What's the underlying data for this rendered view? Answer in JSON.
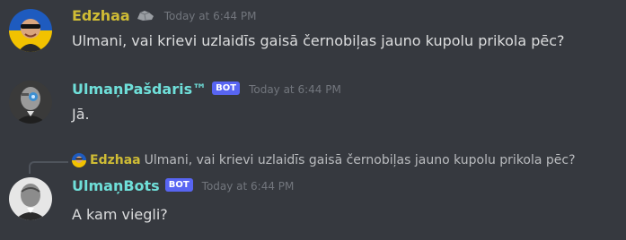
{
  "messages": [
    {
      "author": "Edzhaa",
      "badge_icon": "stone-emoji-icon",
      "timestamp": "Today at 6:44 PM",
      "text": "Ulmani, vai krievi uzlaidīs gaisā černobiļas jauno kupolu prikola pēc?"
    },
    {
      "author": "UlmaņPašdaris™",
      "bot_tag": "BOT",
      "timestamp": "Today at 6:44 PM",
      "text": "Jā."
    },
    {
      "reply": {
        "author": "Edzhaa",
        "text": "Ulmani, vai krievi uzlaidīs gaisā černobiļas jauno kupolu prikola pēc?"
      },
      "author": "UlmaņBots",
      "bot_tag": "BOT",
      "timestamp": "Today at 6:44 PM",
      "text": "A kam viegli?"
    }
  ],
  "colors": {
    "background": "#36393f",
    "edzhaa_name": "#cfbc35",
    "bot_name": "#6fdfd9",
    "bot_tag": "#5865f2",
    "timestamp": "#72767d",
    "message_text": "#dcddde"
  }
}
